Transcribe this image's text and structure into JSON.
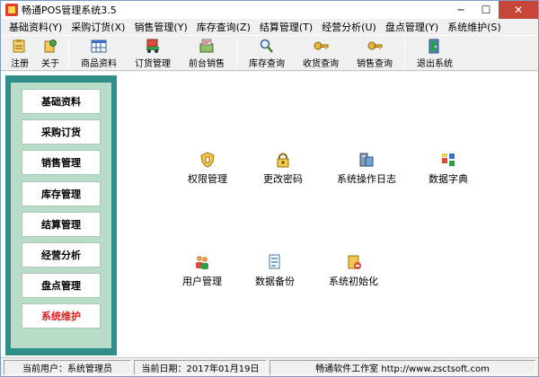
{
  "window": {
    "title": "畅通POS管理系统3.5",
    "controls": {
      "minimize": "─",
      "maximize": "☐",
      "close": "✕"
    }
  },
  "menu": [
    "基础资料(Y)",
    "采购订货(X)",
    "销售管理(Y)",
    "库存查询(Z)",
    "结算管理(T)",
    "经营分析(U)",
    "盘点管理(Y)",
    "系统维护(S)"
  ],
  "toolbar": {
    "register": "注册",
    "about": "关于",
    "products": "商品资料",
    "orders": "订货管理",
    "front_sales": "前台销售",
    "stock_query": "库存查询",
    "receive_query": "收货查询",
    "sales_query": "销售查询",
    "exit": "退出系统"
  },
  "nav": {
    "items": [
      "基础资料",
      "采购订货",
      "销售管理",
      "库存管理",
      "结算管理",
      "经营分析",
      "盘点管理",
      "系统维护"
    ],
    "active_index": 7
  },
  "functions": {
    "permissions": "权限管理",
    "change_password": "更改密码",
    "system_log": "系统操作日志",
    "data_dictionary": "数据字典",
    "user_management": "用户管理",
    "data_backup": "数据备份",
    "system_init": "系统初始化"
  },
  "status": {
    "current_user": "当前用户：系统管理员",
    "current_date": "当前日期：2017年01月19日",
    "company": "畅通软件工作室 http://www.zsctsoft.com"
  },
  "colors": {
    "nav_panel": "#2f8f88",
    "nav_inner": "#b9dcc8",
    "active_text": "#e21b1b",
    "close_button": "#c7463a"
  }
}
